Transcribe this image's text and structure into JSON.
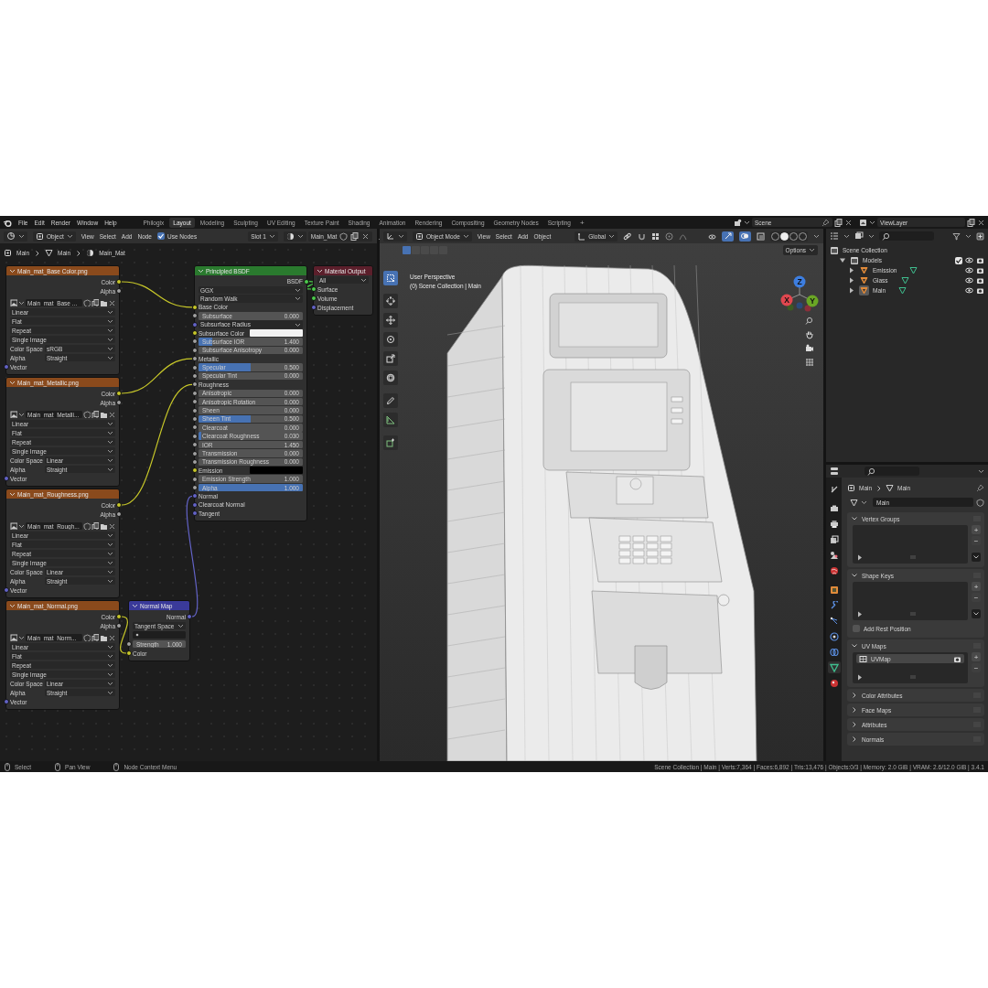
{
  "topbar": {
    "menus": [
      "File",
      "Edit",
      "Render",
      "Window",
      "Help"
    ],
    "workspaces": [
      {
        "label": "Philogix",
        "selected": false
      },
      {
        "label": "Layout",
        "selected": true
      },
      {
        "label": "Modeling",
        "selected": false
      },
      {
        "label": "Sculpting",
        "selected": false
      },
      {
        "label": "UV Editing",
        "selected": false
      },
      {
        "label": "Texture Paint",
        "selected": false
      },
      {
        "label": "Shading",
        "selected": false
      },
      {
        "label": "Animation",
        "selected": false
      },
      {
        "label": "Rendering",
        "selected": false
      },
      {
        "label": "Compositing",
        "selected": false
      },
      {
        "label": "Geometry Nodes",
        "selected": false
      },
      {
        "label": "Scripting",
        "selected": false
      }
    ],
    "add_workspace": "+",
    "scene": "Scene",
    "view_layer": "ViewLayer"
  },
  "node_editor": {
    "header": {
      "object_type": "Object",
      "menus": [
        "View",
        "Select",
        "Add",
        "Node"
      ],
      "use_nodes": {
        "label": "Use Nodes",
        "checked": true
      },
      "slot": "Slot 1",
      "material": "Main_Mat"
    },
    "breadcrumbs": [
      "Main",
      "Main",
      "Main_Mat"
    ],
    "nodes": [
      {
        "title": "Main_mat_Base Color.png",
        "kind": "texture",
        "rows": [
          {
            "kind": "output",
            "label": "Color",
            "socket": {
              "kind": "color"
            }
          },
          {
            "kind": "output",
            "label": "Alpha",
            "socket": {
              "kind": "float"
            }
          },
          {
            "kind": "image",
            "value": "Main_mat_Base ..."
          },
          {
            "kind": "dropdown",
            "value": "Linear"
          },
          {
            "kind": "dropdown",
            "value": "Flat"
          },
          {
            "kind": "dropdown",
            "value": "Repeat"
          },
          {
            "kind": "dropdown",
            "value": "Single Image"
          },
          {
            "kind": "property",
            "label": "Color Space",
            "value": "sRGB"
          },
          {
            "kind": "property",
            "label": "Alpha",
            "value": "Straight"
          },
          {
            "kind": "input",
            "label": "Vector",
            "socket": {
              "kind": "vector"
            }
          }
        ]
      },
      {
        "title": "Main_mat_Metallic.png",
        "kind": "texture",
        "rows": [
          {
            "kind": "output",
            "label": "Color",
            "socket": {
              "kind": "color"
            }
          },
          {
            "kind": "output",
            "label": "Alpha",
            "socket": {
              "kind": "float"
            }
          },
          {
            "kind": "image",
            "value": "Main_mat_Metalli..."
          },
          {
            "kind": "dropdown",
            "value": "Linear"
          },
          {
            "kind": "dropdown",
            "value": "Flat"
          },
          {
            "kind": "dropdown",
            "value": "Repeat"
          },
          {
            "kind": "dropdown",
            "value": "Single Image"
          },
          {
            "kind": "property",
            "label": "Color Space",
            "value": "Linear"
          },
          {
            "kind": "property",
            "label": "Alpha",
            "value": "Straight"
          },
          {
            "kind": "input",
            "label": "Vector",
            "socket": {
              "kind": "vector"
            }
          }
        ]
      },
      {
        "title": "Main_mat_Roughness.png",
        "kind": "texture",
        "rows": [
          {
            "kind": "output",
            "label": "Color",
            "socket": {
              "kind": "color"
            }
          },
          {
            "kind": "output",
            "label": "Alpha",
            "socket": {
              "kind": "float"
            }
          },
          {
            "kind": "image",
            "value": "Main_mat_Rough..."
          },
          {
            "kind": "dropdown",
            "value": "Linear"
          },
          {
            "kind": "dropdown",
            "value": "Flat"
          },
          {
            "kind": "dropdown",
            "value": "Repeat"
          },
          {
            "kind": "dropdown",
            "value": "Single Image"
          },
          {
            "kind": "property",
            "label": "Color Space",
            "value": "Linear"
          },
          {
            "kind": "property",
            "label": "Alpha",
            "value": "Straight"
          },
          {
            "kind": "input",
            "label": "Vector",
            "socket": {
              "kind": "vector"
            }
          }
        ]
      },
      {
        "title": "Main_mat_Normal.png",
        "kind": "texture",
        "rows": [
          {
            "kind": "output",
            "label": "Color",
            "socket": {
              "kind": "color"
            }
          },
          {
            "kind": "output",
            "label": "Alpha",
            "socket": {
              "kind": "float"
            }
          },
          {
            "kind": "image",
            "value": "Main_mat_Norm..."
          },
          {
            "kind": "dropdown",
            "value": "Linear"
          },
          {
            "kind": "dropdown",
            "value": "Flat"
          },
          {
            "kind": "dropdown",
            "value": "Repeat"
          },
          {
            "kind": "dropdown",
            "value": "Single Image"
          },
          {
            "kind": "property",
            "label": "Color Space",
            "value": "Linear"
          },
          {
            "kind": "property",
            "label": "Alpha",
            "value": "Straight"
          },
          {
            "kind": "input",
            "label": "Vector",
            "socket": {
              "kind": "vector"
            }
          }
        ]
      },
      {
        "title": "Normal Map",
        "kind": "vector",
        "rows": [
          {
            "kind": "output",
            "label": "Normal",
            "socket": {
              "kind": "vector"
            }
          },
          {
            "kind": "dropdown",
            "value": "Tangent Space"
          },
          {
            "kind": "field"
          },
          {
            "kind": "number",
            "label": "Strength",
            "value": "1.000",
            "socket": {
              "kind": "float"
            }
          },
          {
            "kind": "input",
            "label": "Color",
            "socket": {
              "kind": "color"
            }
          }
        ]
      },
      {
        "title": "Principled BSDF",
        "kind": "shader",
        "rows": [
          {
            "kind": "output",
            "label": "BSDF",
            "socket": {
              "kind": "shader"
            }
          },
          {
            "kind": "dropdown",
            "value": "GGX"
          },
          {
            "kind": "dropdown",
            "value": "Random Walk"
          },
          {
            "kind": "input",
            "label": "Base Color",
            "socket": {
              "kind": "color"
            }
          },
          {
            "kind": "slider",
            "label": "Subsurface",
            "value": "0.000",
            "level": 0,
            "socket": {
              "kind": "float"
            }
          },
          {
            "kind": "dropdown",
            "value": "Subsurface Radius",
            "socket": {
              "kind": "vector"
            }
          },
          {
            "kind": "color",
            "label": "Subsurface Color",
            "color": "#f2f2f2",
            "socket": {
              "kind": "color"
            }
          },
          {
            "kind": "slider",
            "label": "Subsurface IOR",
            "value": "1.400",
            "level": 0.13,
            "socket": {
              "kind": "float"
            }
          },
          {
            "kind": "slider",
            "label": "Subsurface Anisotropy",
            "value": "0.000",
            "level": 0,
            "socket": {
              "kind": "float"
            }
          },
          {
            "kind": "input",
            "label": "Metallic",
            "socket": {
              "kind": "float"
            }
          },
          {
            "kind": "slider",
            "label": "Specular",
            "value": "0.500",
            "level": 0.5,
            "socket": {
              "kind": "float"
            }
          },
          {
            "kind": "slider",
            "label": "Specular Tint",
            "value": "0.000",
            "level": 0,
            "socket": {
              "kind": "float"
            }
          },
          {
            "kind": "input",
            "label": "Roughness",
            "socket": {
              "kind": "float"
            }
          },
          {
            "kind": "slider",
            "label": "Anisotropic",
            "value": "0.000",
            "level": 0,
            "socket": {
              "kind": "float"
            }
          },
          {
            "kind": "slider",
            "label": "Anisotropic Rotation",
            "value": "0.000",
            "level": 0,
            "socket": {
              "kind": "float"
            }
          },
          {
            "kind": "slider",
            "label": "Sheen",
            "value": "0.000",
            "level": 0,
            "socket": {
              "kind": "float"
            }
          },
          {
            "kind": "slider",
            "label": "Sheen Tint",
            "value": "0.500",
            "level": 0.5,
            "socket": {
              "kind": "float"
            }
          },
          {
            "kind": "slider",
            "label": "Clearcoat",
            "value": "0.000",
            "level": 0,
            "socket": {
              "kind": "float"
            }
          },
          {
            "kind": "slider",
            "label": "Clearcoat Roughness",
            "value": "0.030",
            "level": 0.03,
            "socket": {
              "kind": "float"
            }
          },
          {
            "kind": "slider",
            "label": "IOR",
            "value": "1.450",
            "level": 0,
            "socket": {
              "kind": "float"
            }
          },
          {
            "kind": "slider",
            "label": "Transmission",
            "value": "0.000",
            "level": 0,
            "socket": {
              "kind": "float"
            }
          },
          {
            "kind": "slider",
            "label": "Transmission Roughness",
            "value": "0.000",
            "level": 0,
            "socket": {
              "kind": "float"
            }
          },
          {
            "kind": "color",
            "label": "Emission",
            "color": "#000000",
            "socket": {
              "kind": "color"
            }
          },
          {
            "kind": "slider",
            "label": "Emission Strength",
            "value": "1.000",
            "level": 0,
            "socket": {
              "kind": "float"
            }
          },
          {
            "kind": "slider",
            "label": "Alpha",
            "value": "1.000",
            "level": 1,
            "socket": {
              "kind": "float"
            }
          },
          {
            "kind": "input",
            "label": "Normal",
            "socket": {
              "kind": "vector"
            }
          },
          {
            "kind": "input",
            "label": "Clearcoat Normal",
            "socket": {
              "kind": "vector"
            }
          },
          {
            "kind": "input",
            "label": "Tangent",
            "socket": {
              "kind": "vector"
            }
          }
        ]
      },
      {
        "title": "Material Output",
        "kind": "output",
        "rows": [
          {
            "kind": "dropdown",
            "value": "All"
          },
          {
            "kind": "input",
            "label": "Surface",
            "socket": {
              "kind": "shader"
            }
          },
          {
            "kind": "input",
            "label": "Volume",
            "socket": {
              "kind": "shader"
            }
          },
          {
            "kind": "input",
            "label": "Displacement",
            "socket": {
              "kind": "vector"
            }
          }
        ]
      }
    ]
  },
  "viewport": {
    "header": {
      "mode": "Object Mode",
      "menus": [
        "View",
        "Select",
        "Add",
        "Object"
      ],
      "orientation": "Global",
      "gizmos": true,
      "overlays": true,
      "shading": [
        {
          "selected": false
        },
        {
          "selected": true
        },
        {
          "selected": false
        },
        {
          "selected": false
        }
      ],
      "options": "Options"
    },
    "select_modes": [
      {
        "selected": true
      },
      {
        "selected": false
      },
      {
        "selected": false
      },
      {
        "selected": false
      },
      {
        "selected": false
      }
    ],
    "view_name": "User Perspective",
    "collection_info": "(0) Scene Collection | Main",
    "tools": [
      {
        "selected": true
      },
      {
        "selected": false
      },
      {
        "selected": false
      },
      {
        "selected": false
      },
      {
        "selected": false
      },
      {
        "selected": false
      },
      {
        "selected": false
      },
      {
        "selected": false
      },
      {
        "selected": false
      }
    ],
    "axes": [
      "X",
      "Y",
      "Z"
    ]
  },
  "outliner": {
    "tree": [
      {
        "label": "Scene Collection",
        "kind": "scene",
        "children": [
          {
            "label": "Models",
            "kind": "collection",
            "expanded": true,
            "checked": true,
            "children": [
              {
                "label": "Emission",
                "kind": "object",
                "expanded": false,
                "active": false
              },
              {
                "label": "Glass",
                "kind": "object",
                "expanded": false,
                "active": false
              },
              {
                "label": "Main",
                "kind": "object",
                "expanded": false,
                "active": true
              }
            ]
          }
        ]
      }
    ]
  },
  "properties": {
    "tabs": [
      {
        "selected": false
      },
      {
        "selected": false
      },
      {
        "selected": false
      },
      {
        "selected": false
      },
      {
        "selected": false
      },
      {
        "selected": false
      },
      {
        "selected": false
      },
      {
        "selected": false
      },
      {
        "selected": false
      },
      {
        "selected": false
      },
      {
        "selected": false
      },
      {
        "selected": true
      },
      {
        "selected": false
      }
    ],
    "breadcrumbs": [
      "Main",
      "Main"
    ],
    "datablock": "Main",
    "panels": [
      {
        "title": "Vertex Groups",
        "expanded": true,
        "buttons": [
          "+",
          "−"
        ]
      },
      {
        "title": "Shape Keys",
        "expanded": true,
        "buttons": [
          "+",
          "−"
        ],
        "checkbox": {
          "label": "Add Rest Position",
          "checked": false
        }
      },
      {
        "title": "UV Maps",
        "expanded": true,
        "buttons": [
          "+",
          "−"
        ],
        "items": [
          {
            "label": "UVMap",
            "selected": true
          }
        ]
      },
      {
        "title": "Color Attributes",
        "expanded": false
      },
      {
        "title": "Face Maps",
        "expanded": false
      },
      {
        "title": "Attributes",
        "expanded": false
      },
      {
        "title": "Normals",
        "expanded": false
      }
    ]
  },
  "status_bar": {
    "hints": [
      "Select",
      "Pan View",
      "Node Context Menu"
    ],
    "stats": "Scene Collection | Main | Verts:7,364 | Faces:6,892 | Tris:13,476 | Objects:0/3 | Memory: 2.0 GiB | VRAM: 2.6/12.0 GiB | 3.4.1"
  }
}
